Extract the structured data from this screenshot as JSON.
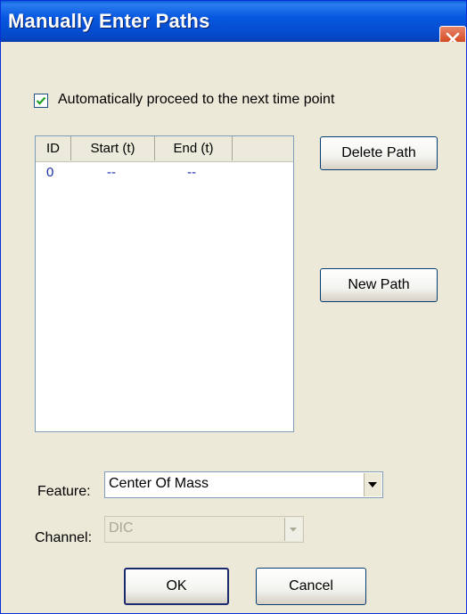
{
  "window": {
    "title": "Manually Enter Paths"
  },
  "options": {
    "auto_proceed_label": "Automatically proceed to the next time point",
    "auto_proceed_checked": true
  },
  "path_list": {
    "columns": [
      "ID",
      "Start (t)",
      "End (t)"
    ],
    "rows": [
      {
        "id": "0",
        "start": "--",
        "end": "--"
      }
    ]
  },
  "buttons": {
    "delete_path": "Delete Path",
    "new_path": "New Path",
    "ok": "OK",
    "cancel": "Cancel"
  },
  "feature": {
    "label": "Feature:",
    "value": "Center Of Mass"
  },
  "channel": {
    "label": "Channel:",
    "value": "DIC",
    "disabled": true
  },
  "icons": {
    "close": "close-icon",
    "check": "checkmark-icon",
    "dropdown": "chevron-down-icon"
  },
  "colors": {
    "titlebar": "#0a5fd8",
    "dialog_bg": "#ece9d8",
    "close_button": "#d9542e",
    "list_value": "#1a2fa8"
  }
}
